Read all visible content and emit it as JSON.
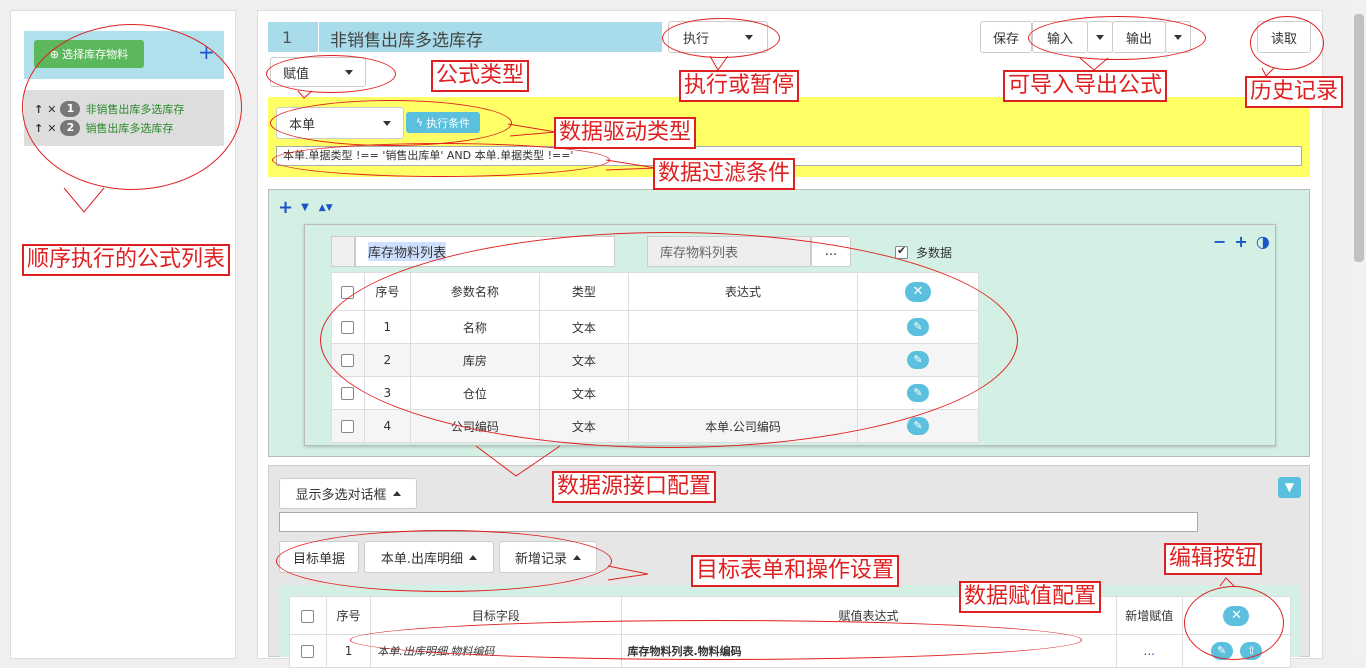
{
  "sidebar": {
    "select_button": "选择库存物料",
    "add": "+",
    "items": [
      {
        "num": "1",
        "label": "非销售出库多选库存"
      },
      {
        "num": "2",
        "label": "销售出库多选库存"
      }
    ]
  },
  "header": {
    "formula_no": "1",
    "formula_name": "非销售出库多选库存",
    "exec_select": "执行",
    "save": "保存",
    "import": "输入",
    "export": "输出",
    "read": "读取",
    "formula_type": "赋值"
  },
  "driver": {
    "source_select": "本单",
    "exec_condition": "执行条件",
    "filter": "本单.单据类型 !== '销售出库单' AND  本单.单据类型 !=='"
  },
  "toolbar_icons": {
    "add": "+",
    "down": "⌄"
  },
  "datasource": {
    "name_input": "库存物料列表",
    "name_readonly": "库存物料列表",
    "ellipsis": "...",
    "multi_data": "多数据",
    "columns": [
      "序号",
      "参数名称",
      "类型",
      "表达式"
    ],
    "rows": [
      {
        "no": "1",
        "name": "名称",
        "type": "文本",
        "expr": ""
      },
      {
        "no": "2",
        "name": "库房",
        "type": "文本",
        "expr": ""
      },
      {
        "no": "3",
        "name": "仓位",
        "type": "文本",
        "expr": ""
      },
      {
        "no": "4",
        "name": "公司编码",
        "type": "文本",
        "expr": "本单.公司编码"
      }
    ]
  },
  "target": {
    "dialog_button": "显示多选对话框",
    "target_form": "目标单据",
    "detail": "本单.出库明细",
    "action": "新增记录",
    "columns": [
      "序号",
      "目标字段",
      "赋值表达式",
      "新增赋值"
    ],
    "rows": [
      {
        "no": "1",
        "field": "本单.出库明细.物料编码",
        "expr": "库存物料列表.物料编码",
        "extra": "..."
      }
    ]
  },
  "annotations": {
    "formula_type": "公式类型",
    "exec_or_pause": "执行或暂停",
    "import_export": "可导入导出公式",
    "history": "历史记录",
    "driver_type": "数据驱动类型",
    "filter": "数据过滤条件",
    "formula_list": "顺序执行的公式列表",
    "datasource_config": "数据源接口配置",
    "target_config": "目标表单和操作设置",
    "edit_buttons": "编辑按钮",
    "assign_config": "数据赋值配置"
  },
  "colors": {
    "accent": "#5bc0de",
    "green_btn": "#5cb85c",
    "yellow": "#ffff66",
    "mint": "#d4efe3",
    "red": "#e02020"
  }
}
